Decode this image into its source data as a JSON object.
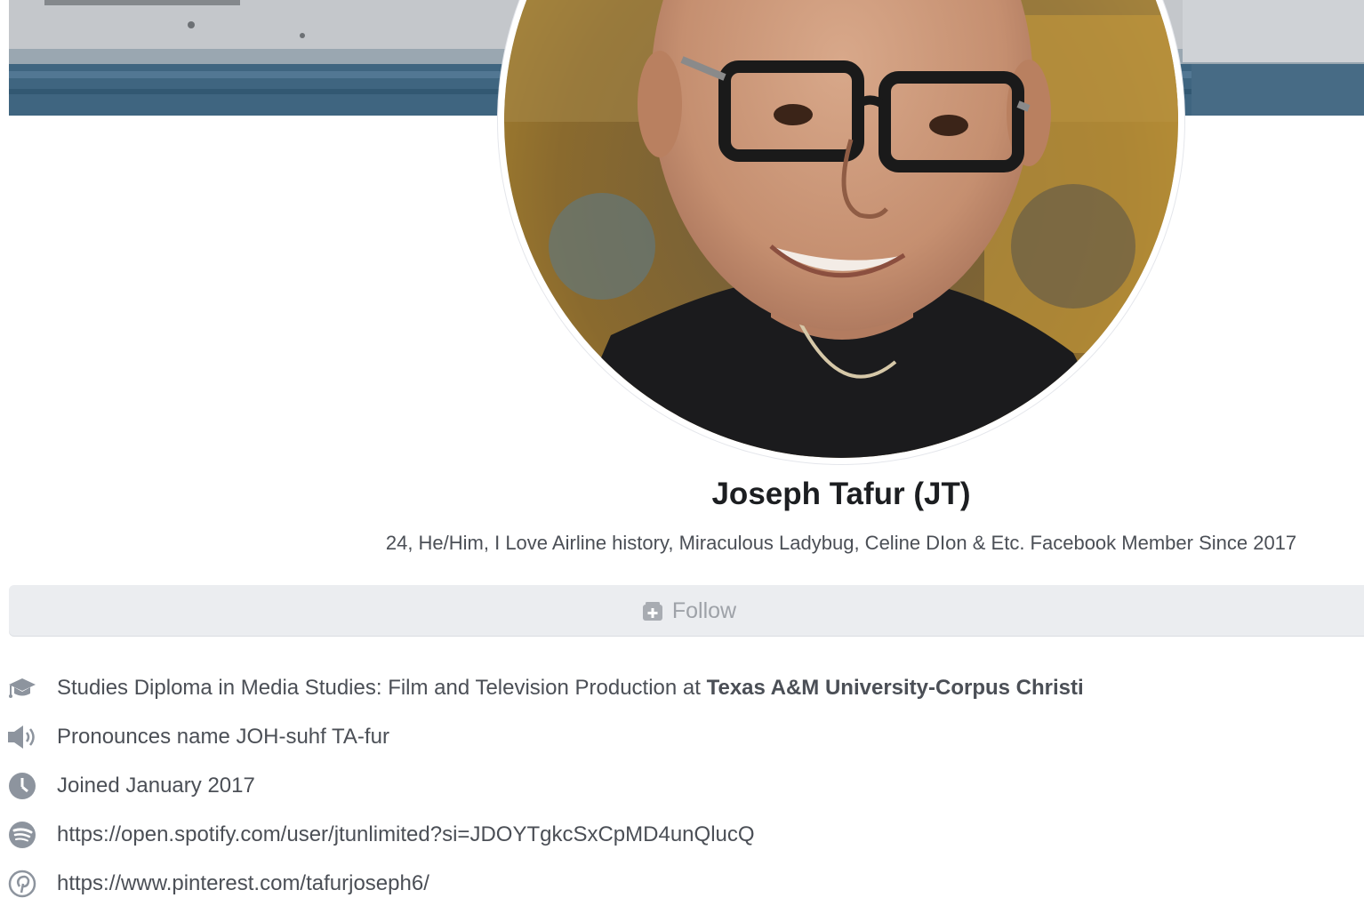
{
  "profile": {
    "name": "Joseph Tafur (JT)",
    "bio": "24, He/Him, I Love Airline history, Miraculous Ladybug, Celine DIon & Etc. Facebook Member Since 2017"
  },
  "actions": {
    "follow_label": "Follow"
  },
  "intro": {
    "education_prefix": "Studies Diploma in Media Studies: Film and Television Production at ",
    "education_school": "Texas A&M University-Corpus Christi",
    "pronunciation": "Pronounces name JOH-suhf TA-fur",
    "joined": "Joined January 2017",
    "spotify_link": "https://open.spotify.com/user/jtunlimited?si=JDOYTgkcSxCpMD4unQlucQ",
    "pinterest_link": "https://www.pinterest.com/tafurjoseph6/"
  },
  "icons": {
    "education": "graduation-cap-icon",
    "pronunciation": "speaker-icon",
    "joined": "clock-icon",
    "spotify": "spotify-icon",
    "pinterest": "pinterest-icon",
    "follow": "follow-icon"
  },
  "colors": {
    "text_primary": "#1c1e21",
    "text_secondary": "#4b4f56",
    "button_bg": "#ebedf0",
    "button_text": "#9ea2a8",
    "icon_gray": "#8d949e"
  }
}
